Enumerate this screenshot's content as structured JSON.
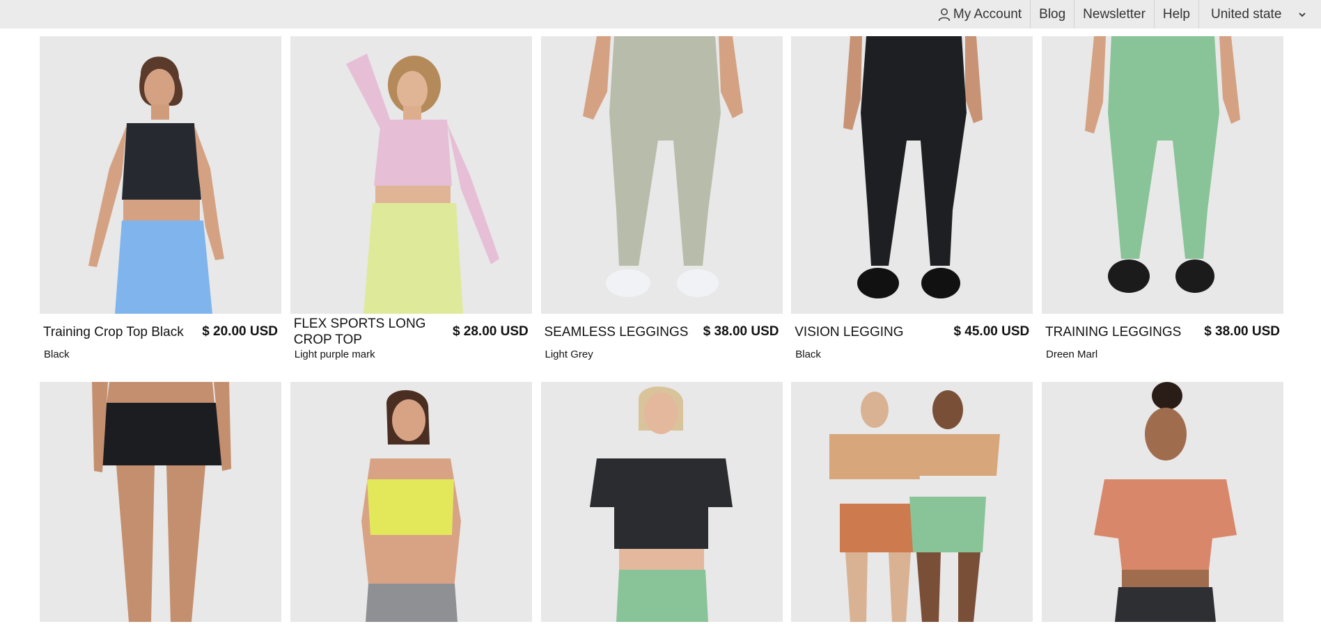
{
  "nav": {
    "account_label": "My Account",
    "account_icon": "person-icon",
    "blog_label": "Blog",
    "newsletter_label": "Newsletter",
    "help_label": "Help",
    "region_label": "United state",
    "region_icon": "chevron-down-icon"
  },
  "products": [
    {
      "name": "Training Crop Top Black",
      "price": "$ 20.00 USD",
      "color": "Black"
    },
    {
      "name": "FLEX SPORTS LONG CROP TOP",
      "price": "$ 28.00 USD",
      "color": "Light purple mark"
    },
    {
      "name": "SEAMLESS LEGGINGS",
      "price": "$ 38.00 USD",
      "color": "Light Grey"
    },
    {
      "name": "VISION LEGGING",
      "price": "$ 45.00 USD",
      "color": "Black"
    },
    {
      "name": "TRAINING LEGGINGS",
      "price": "$ 38.00 USD",
      "color": "Dreen Marl"
    }
  ],
  "colors": {
    "topbar_bg": "#ebebeb",
    "photo_bg": "#e6e6e6",
    "skin": "#d4a283",
    "black_top": "#262a30",
    "blue_shorts": "#7fb5ec",
    "pink_top": "#e6bfd6",
    "lime_shorts": "#dfe99a",
    "grey_leggings": "#b8bcaa",
    "green_leggings": "#88c497",
    "yellow_bra": "#e3e85a",
    "orange_tee": "#d9876a",
    "tan_tee": "#d7a77b"
  }
}
